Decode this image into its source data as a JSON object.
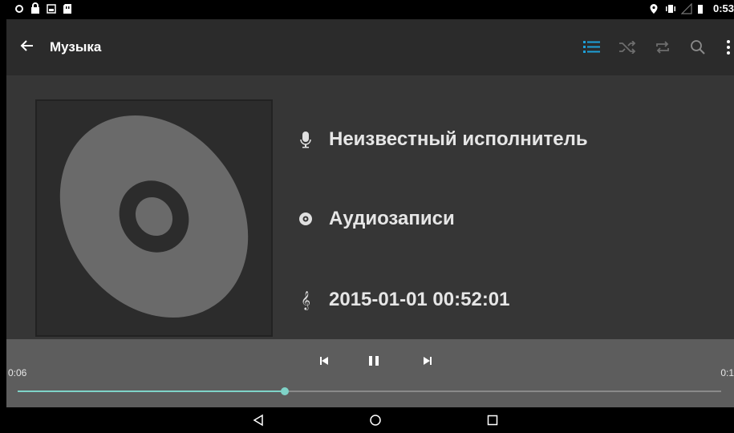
{
  "statusbar": {
    "time": "0:53"
  },
  "toolbar": {
    "title": "Музыка",
    "accent": "#1ea0d8"
  },
  "track": {
    "artist": "Неизвестный исполнитель",
    "album": "Аудиозаписи",
    "title": "2015-01-01 00:52:01"
  },
  "player": {
    "elapsed": "0:06",
    "duration": "0:1",
    "progress": 0.38,
    "seek_color": "#7fd3c8"
  },
  "icons": {
    "back": "arrow-left-icon",
    "queue": "queue-list-icon",
    "shuffle": "shuffle-icon",
    "repeat": "repeat-icon",
    "search": "search-icon",
    "menu": "more-vert-icon",
    "artist": "microphone-icon",
    "album": "disc-icon",
    "title": "treble-clef-icon"
  }
}
